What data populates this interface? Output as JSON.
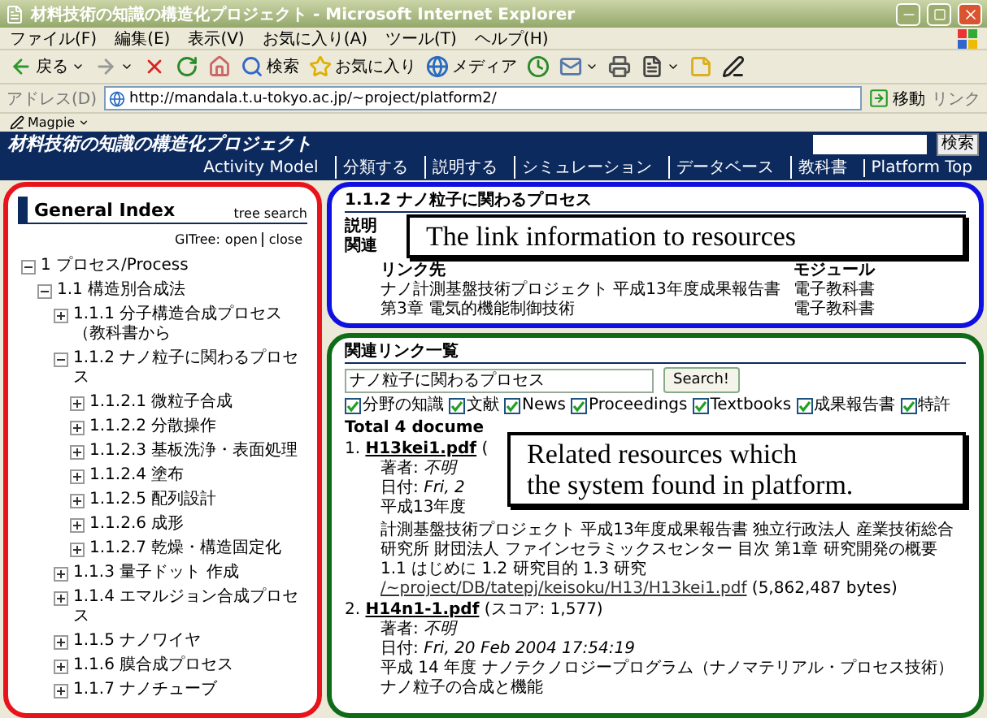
{
  "window": {
    "title": "材料技術の知識の構造化プロジェクト - Microsoft Internet Explorer"
  },
  "menu": [
    "ファイル(F)",
    "編集(E)",
    "表示(V)",
    "お気に入り(A)",
    "ツール(T)",
    "ヘルプ(H)"
  ],
  "toolbar": [
    {
      "kind": "back",
      "label": "戻る",
      "has_menu": true
    },
    {
      "kind": "forward",
      "has_menu": true
    },
    {
      "kind": "stop",
      "has_menu": false
    },
    {
      "kind": "refresh",
      "has_menu": false
    },
    {
      "kind": "home",
      "has_menu": false
    },
    {
      "kind": "search",
      "label": "検索",
      "has_menu": false
    },
    {
      "kind": "favorites",
      "label": "お気に入り",
      "has_menu": false
    },
    {
      "kind": "media",
      "label": "メディア",
      "has_menu": false
    },
    {
      "kind": "history",
      "has_menu": false
    },
    {
      "kind": "mail",
      "has_menu": true
    },
    {
      "kind": "print",
      "has_menu": false
    },
    {
      "kind": "edit",
      "has_menu": true
    },
    {
      "kind": "note",
      "has_menu": false
    },
    {
      "kind": "pen",
      "has_menu": false
    }
  ],
  "address": {
    "label": "アドレス(D)",
    "url": "http://mandala.t.u-tokyo.ac.jp/~project/platform2/",
    "go": "移動",
    "links": "リンク"
  },
  "links_bar": {
    "item": "Magpie"
  },
  "site": {
    "title": "材料技術の知識の構造化プロジェクト",
    "nav": [
      "Activity Model",
      "分類する",
      "説明する",
      "シミュレーション",
      "データベース",
      "教科書",
      "Platform Top"
    ],
    "search_button": "検索"
  },
  "left_panel": {
    "frame": {
      "color": "#e8141b"
    },
    "heading": "General Index",
    "tree_search": "tree search",
    "gitree_label": "GITree:",
    "gitree_links": [
      "open",
      "close"
    ],
    "tree": [
      {
        "label": "1 プロセス/Process",
        "expanded": true,
        "children": [
          {
            "label": "1.1 構造別合成法",
            "expanded": true,
            "children": [
              {
                "label": "1.1.1 分子構造合成プロセス（教科書から",
                "expanded": false
              },
              {
                "label": "1.1.2 ナノ粒子に関わるプロセス",
                "expanded": true,
                "children": [
                  {
                    "label": "1.1.2.1 微粒子合成",
                    "expanded": false
                  },
                  {
                    "label": "1.1.2.2 分散操作",
                    "expanded": false
                  },
                  {
                    "label": "1.1.2.3 基板洗浄・表面処理",
                    "expanded": false
                  },
                  {
                    "label": "1.1.2.4 塗布",
                    "expanded": false
                  },
                  {
                    "label": "1.1.2.5 配列設計",
                    "expanded": false
                  },
                  {
                    "label": "1.1.2.6 成形",
                    "expanded": false
                  },
                  {
                    "label": "1.1.2.7 乾燥・構造固定化",
                    "expanded": false
                  }
                ]
              },
              {
                "label": "1.1.3 量子ドット 作成",
                "expanded": false
              },
              {
                "label": "1.1.4 エマルジョン合成プロセス",
                "expanded": false
              },
              {
                "label": "1.1.5 ナノワイヤ",
                "expanded": false
              },
              {
                "label": "1.1.6 膜合成プロセス",
                "expanded": false
              },
              {
                "label": "1.1.7 ナノチューブ",
                "expanded": false
              }
            ]
          }
        ]
      }
    ]
  },
  "related_info": {
    "frame": {
      "color": "#1010e0"
    },
    "heading": "1.1.2 ナノ粒子に関わるプロセス",
    "labels": [
      "説明",
      "関連"
    ],
    "callout": "The link information to resources",
    "columns": [
      "リンク先",
      "モジュール"
    ],
    "rows": [
      [
        "ナノ計測基盤技術プロジェクト 平成13年度成果報告書",
        "電子教科書"
      ],
      [
        "第3章 電気的機能制御技術",
        "電子教科書"
      ]
    ]
  },
  "related_links": {
    "frame": {
      "color": "#0e6b16"
    },
    "heading": "関連リンク一覧",
    "query": "ナノ粒子に関わるプロセス",
    "search_button": "Search!",
    "filters": [
      {
        "label": "分野の知識",
        "checked": true
      },
      {
        "label": "文献",
        "checked": true
      },
      {
        "label": "News",
        "checked": true
      },
      {
        "label": "Proceedings",
        "checked": true
      },
      {
        "label": "Textbooks",
        "checked": true
      },
      {
        "label": "成果報告書",
        "checked": true
      },
      {
        "label": "特許",
        "checked": true
      }
    ],
    "total": "Total 4 docume",
    "callout_lines": [
      "Related resources which",
      "the system found in platform."
    ],
    "results": [
      {
        "kind": "partial",
        "number": "1.",
        "link": "H13kei1.pdf",
        "score": "(",
        "author_label": "著者:",
        "author": "不明",
        "date_label": "日付:",
        "date": "Fri, 2",
        "abstract_head": "平成13年度",
        "abstract": "計測基盤技術プロジェクト 平成13年度成果報告書 独立行政法人 産業技術総合研究所 財団法人 ファインセラミックスセンター 目次 第1章 研究開発の概要 1.1 はじめに 1.2 研究目的 1.3 研究",
        "url": "/~project/DB/tatepj/keisoku/H13/H13kei1.pdf",
        "size": "(5,862,487 bytes)"
      },
      {
        "kind": "full",
        "number": "2.",
        "link": "H14n1-1.pdf",
        "score": "(スコア: 1,577)",
        "author_label": "著者:",
        "author": "不明",
        "date_label": "日付:",
        "date": "Fri, 20 Feb 2004 17:54:19",
        "abstract": "平成 14 年度 ナノテクノロジープログラム（ナノマテリアル・プロセス技術）ナノ粒子の合成と機能"
      }
    ]
  }
}
